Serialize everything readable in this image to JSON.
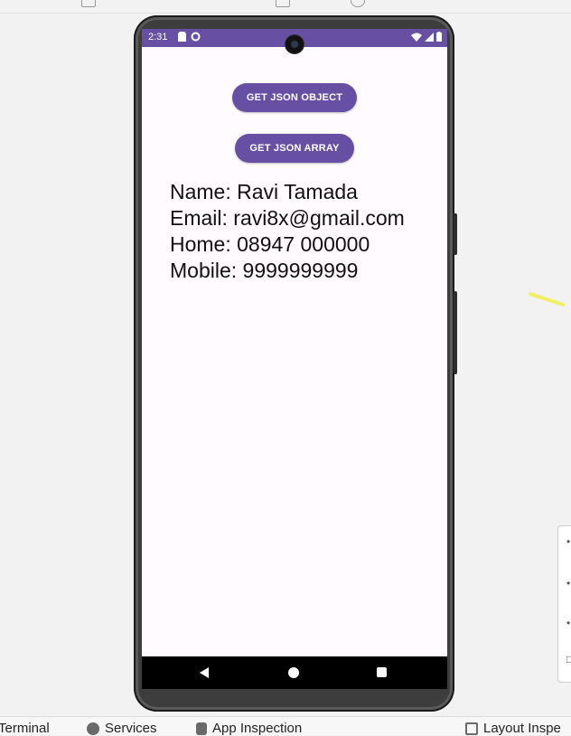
{
  "status_bar": {
    "time": "2:31",
    "color": "#6750a4",
    "left_icons": [
      "sim-icon",
      "data-saver-icon"
    ],
    "right_icons": [
      "wifi-icon",
      "signal-icon",
      "battery-icon"
    ]
  },
  "buttons": {
    "get_json_object": "GET JSON OBJECT",
    "get_json_array": "GET JSON ARRAY",
    "accent": "#6750a4"
  },
  "contact": {
    "name": "Name: Ravi Tamada",
    "email": "Email: ravi8x@gmail.com",
    "home": "Home: 08947 000000",
    "mobile": "Mobile: 9999999999"
  },
  "nav": {
    "icons": [
      "back-icon",
      "home-icon",
      "recents-icon"
    ]
  },
  "tool_window_bar": {
    "terminal": "Terminal",
    "services": "Services",
    "app_inspection": "App Inspection",
    "layout_inspector": "Layout Inspe"
  }
}
